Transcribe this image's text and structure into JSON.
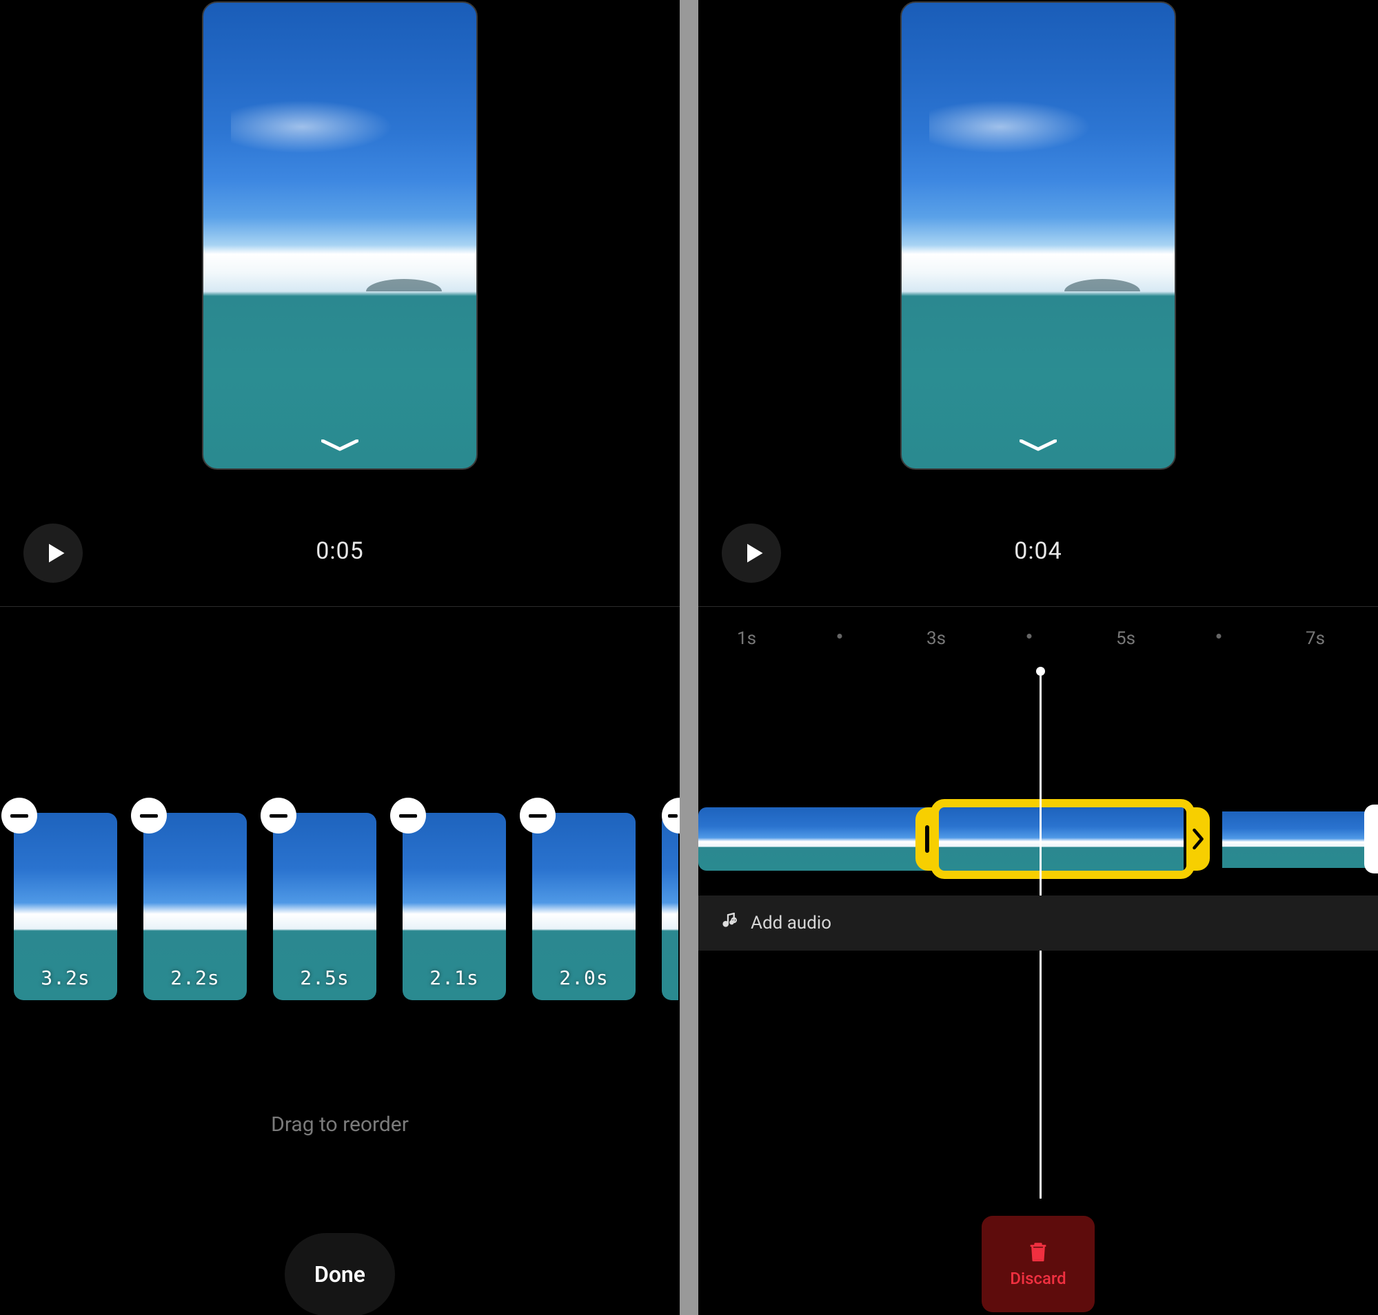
{
  "left": {
    "play_time": "0:05",
    "clips": [
      {
        "duration": "3.2s"
      },
      {
        "duration": "2.2s"
      },
      {
        "duration": "2.5s"
      },
      {
        "duration": "2.1s"
      },
      {
        "duration": "2.0s"
      }
    ],
    "drag_hint": "Drag to reorder",
    "done_label": "Done"
  },
  "right": {
    "play_time": "0:04",
    "ruler": {
      "labels": [
        "1s",
        "3s",
        "5s",
        "7s"
      ]
    },
    "add_audio_label": "Add audio",
    "discard_label": "Discard"
  }
}
